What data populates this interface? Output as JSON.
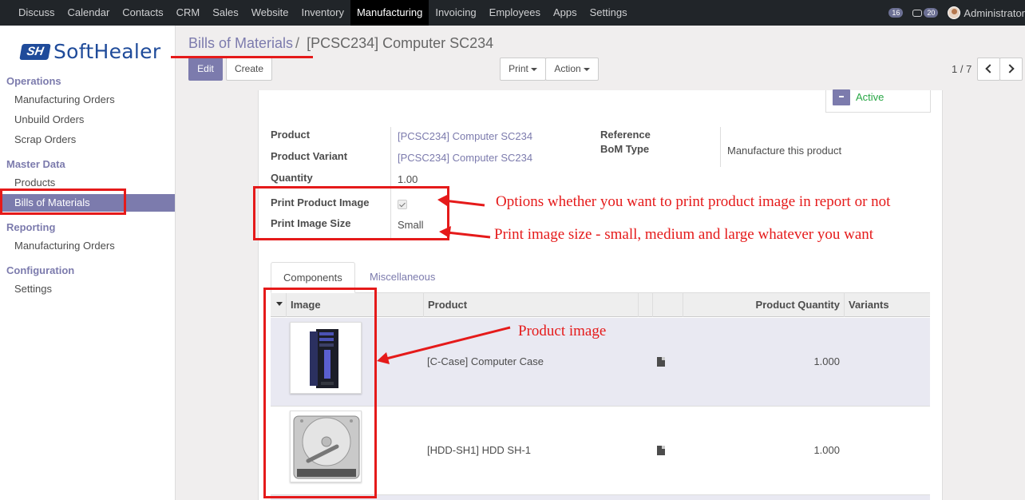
{
  "topnav": {
    "items": [
      "Discuss",
      "Calendar",
      "Contacts",
      "CRM",
      "Sales",
      "Website",
      "Inventory",
      "Manufacturing",
      "Invoicing",
      "Employees",
      "Apps",
      "Settings"
    ],
    "active": "Manufacturing",
    "activity_count": "16",
    "message_count": "20",
    "user": "Administrator"
  },
  "sidebar": {
    "logo_mark": "SH",
    "logo_text": "SoftHealer",
    "sections": [
      {
        "title": "Operations",
        "items": [
          "Manufacturing Orders",
          "Unbuild Orders",
          "Scrap Orders"
        ]
      },
      {
        "title": "Master Data",
        "items": [
          "Products",
          "Bills of Materials"
        ]
      },
      {
        "title": "Reporting",
        "items": [
          "Manufacturing Orders"
        ]
      },
      {
        "title": "Configuration",
        "items": [
          "Settings"
        ]
      }
    ],
    "active_item": "Bills of Materials"
  },
  "breadcrumb": {
    "parent": "Bills of Materials",
    "separator": "/",
    "current": "[PCSC234] Computer SC234"
  },
  "control": {
    "edit_label": "Edit",
    "create_label": "Create",
    "print_label": "Print",
    "action_label": "Action",
    "pager": "1 / 7"
  },
  "status": {
    "label": "Active",
    "color": "#28a745"
  },
  "form": {
    "product_label": "Product",
    "product_value": "[PCSC234] Computer SC234",
    "variant_label": "Product Variant",
    "variant_value": "[PCSC234] Computer SC234",
    "quantity_label": "Quantity",
    "quantity_value": "1.00",
    "print_image_label": "Print Product Image",
    "print_image_checked": true,
    "image_size_label": "Print Image Size",
    "image_size_value": "Small",
    "reference_label": "Reference",
    "bom_type_label": "BoM Type",
    "bom_type_value": "Manufacture this product"
  },
  "annotations": {
    "print_option": "Options whether you want to print product image in report or not",
    "image_size": "Print image size - small, medium and large whatever you want",
    "product_image": "Product image",
    "color": "#e51a1a"
  },
  "tabs": [
    "Components",
    "Miscellaneous"
  ],
  "table": {
    "columns": [
      "Image",
      "Product",
      "Product Quantity",
      "Variants"
    ],
    "rows": [
      {
        "image": "computer-case",
        "product": "[C-Case] Computer Case",
        "quantity": "1.000",
        "variants": ""
      },
      {
        "image": "hard-drive",
        "product": "[HDD-SH1] HDD SH-1",
        "quantity": "1.000",
        "variants": ""
      }
    ]
  },
  "colors": {
    "accent": "#7c7bad",
    "topbar": "#212529"
  }
}
